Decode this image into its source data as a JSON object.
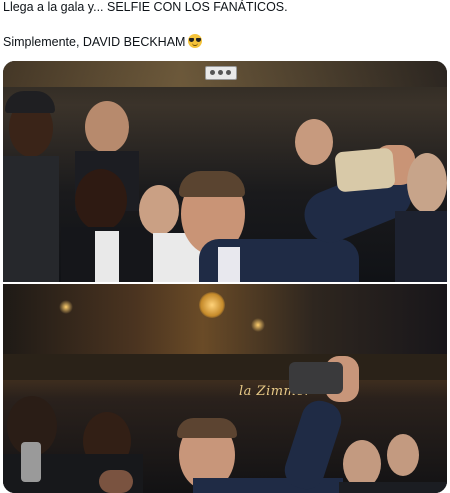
{
  "post": {
    "line_1": "Llega a la gala y... SELFIE CON LOS FANÁTICOS.",
    "line_2": "Simplemente, DAVID BECKHAM",
    "emoji": "smiling-face-with-sunglasses"
  },
  "media": {
    "photo_1": {
      "description_icon": "selfie-photo"
    },
    "photo_2": {
      "sign_text": "la Zimmer"
    }
  }
}
